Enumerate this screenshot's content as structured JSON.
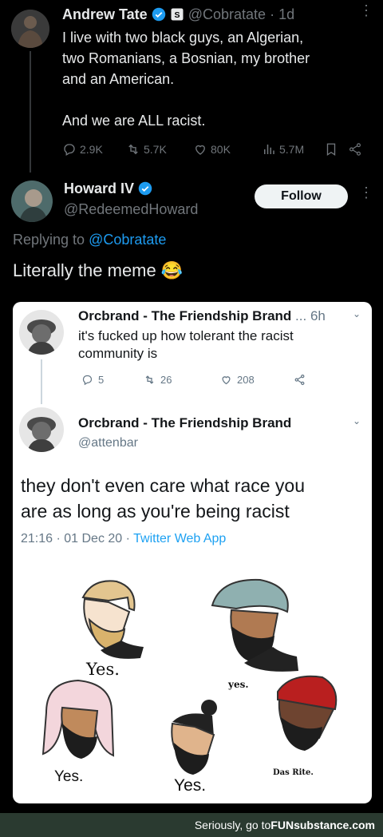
{
  "tweet1": {
    "name": "Andrew Tate",
    "handle": "@Cobratate",
    "time": "· 1d",
    "text_line1": "I live with two black guys, an Algerian,",
    "text_line2": "two Romanians, a Bosnian, my brother",
    "text_line3": "and an American.",
    "text_line4": "And we are ALL racist.",
    "replies": "2.9K",
    "retweets": "5.7K",
    "likes": "80K",
    "views": "5.7M"
  },
  "tweet2": {
    "name": "Howard IV",
    "handle": "@RedeemedHoward",
    "follow_label": "Follow",
    "replying_prefix": "Replying to",
    "replying_handle": "@Cobratate",
    "text": "Literally the meme 😂"
  },
  "embedded": {
    "t1_name": "Orcbrand - The Friendship Brand",
    "t1_ellipsis": "...",
    "t1_time": "6h",
    "t1_line1": "it's fucked up how tolerant the racist",
    "t1_line2": "community is",
    "t1_replies": "5",
    "t1_retweets": "26",
    "t1_likes": "208",
    "t2_name": "Orcbrand - The Friendship Brand",
    "t2_handle": "@attenbar",
    "t2_line1": "they don't even care what race you",
    "t2_line2": "are as long as you're being racist",
    "t2_time": "21:16 · 01 Dec 20 ·",
    "t2_source": "Twitter Web App",
    "meme_captions": [
      "Yes.",
      "yes.",
      "Yes.",
      "Yes.",
      "Das Rite."
    ]
  },
  "footer": {
    "text": "Seriously, go to ",
    "brand": "FUNsubstance.com"
  },
  "colors": {
    "background": "#000000",
    "link_blue": "#1d9bf0",
    "verified_blue": "#1d9bf0",
    "footer_bg": "#2a3a30"
  }
}
